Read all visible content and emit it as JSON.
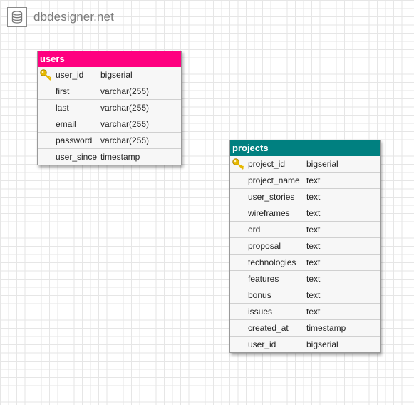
{
  "brand": {
    "name": "dbdesigner.net",
    "icon": "database-icon"
  },
  "colors": {
    "users_header": "#ff0080",
    "projects_header": "#008080",
    "key_icon": "#e6b800"
  },
  "tables": {
    "users": {
      "title": "users",
      "columns": [
        {
          "name": "user_id",
          "type": "bigserial",
          "primary_key": true
        },
        {
          "name": "first",
          "type": "varchar(255)",
          "primary_key": false
        },
        {
          "name": "last",
          "type": "varchar(255)",
          "primary_key": false
        },
        {
          "name": "email",
          "type": "varchar(255)",
          "primary_key": false
        },
        {
          "name": "password",
          "type": "varchar(255)",
          "primary_key": false
        },
        {
          "name": "user_since",
          "type": "timestamp",
          "primary_key": false
        }
      ]
    },
    "projects": {
      "title": "projects",
      "columns": [
        {
          "name": "project_id",
          "type": "bigserial",
          "primary_key": true
        },
        {
          "name": "project_name",
          "type": "text",
          "primary_key": false
        },
        {
          "name": "user_stories",
          "type": "text",
          "primary_key": false
        },
        {
          "name": "wireframes",
          "type": "text",
          "primary_key": false
        },
        {
          "name": "erd",
          "type": "text",
          "primary_key": false
        },
        {
          "name": "proposal",
          "type": "text",
          "primary_key": false
        },
        {
          "name": "technologies",
          "type": "text",
          "primary_key": false
        },
        {
          "name": "features",
          "type": "text",
          "primary_key": false
        },
        {
          "name": "bonus",
          "type": "text",
          "primary_key": false
        },
        {
          "name": "issues",
          "type": "text",
          "primary_key": false
        },
        {
          "name": "created_at",
          "type": "timestamp",
          "primary_key": false
        },
        {
          "name": "user_id",
          "type": "bigserial",
          "primary_key": false
        }
      ]
    }
  }
}
